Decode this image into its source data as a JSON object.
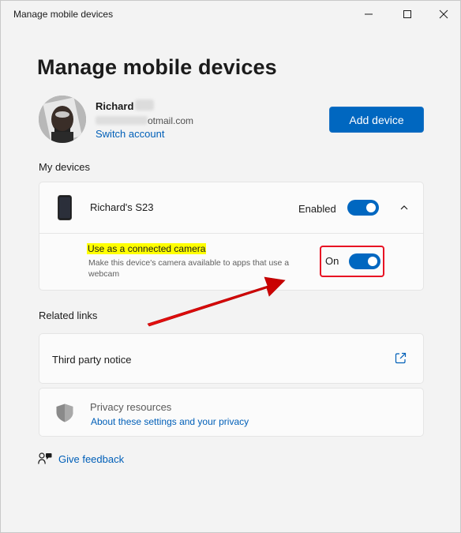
{
  "window": {
    "title": "Manage mobile devices",
    "minimize_icon": "minimize-icon",
    "maximize_icon": "maximize-icon",
    "close_icon": "close-icon"
  },
  "page": {
    "title": "Manage mobile devices"
  },
  "account": {
    "name": "Richard",
    "email_visible": "otmail.com",
    "switch_label": "Switch account",
    "avatar_icon": "profile-photo"
  },
  "add_device": {
    "label": "Add device"
  },
  "my_devices": {
    "heading": "My devices",
    "device": {
      "icon": "phone-icon",
      "name": "Richard's S23",
      "enabled_label": "Enabled",
      "enabled": true,
      "expanded_icon": "chevron-up-icon",
      "camera": {
        "title": "Use as a connected camera",
        "description": "Make this device's camera available to apps that use a webcam",
        "state_label": "On",
        "on": true
      }
    }
  },
  "related_links": {
    "heading": "Related links",
    "third_party": {
      "label": "Third party notice",
      "icon": "external-link-icon"
    },
    "privacy": {
      "icon": "shield-icon",
      "label": "Privacy resources",
      "link": "About these settings and your privacy"
    }
  },
  "feedback": {
    "label": "Give feedback",
    "icon": "feedback-icon"
  },
  "colors": {
    "accent": "#0067c0",
    "link": "#005fb8",
    "highlight": "#ffff00",
    "annotation_red": "#e81123"
  }
}
